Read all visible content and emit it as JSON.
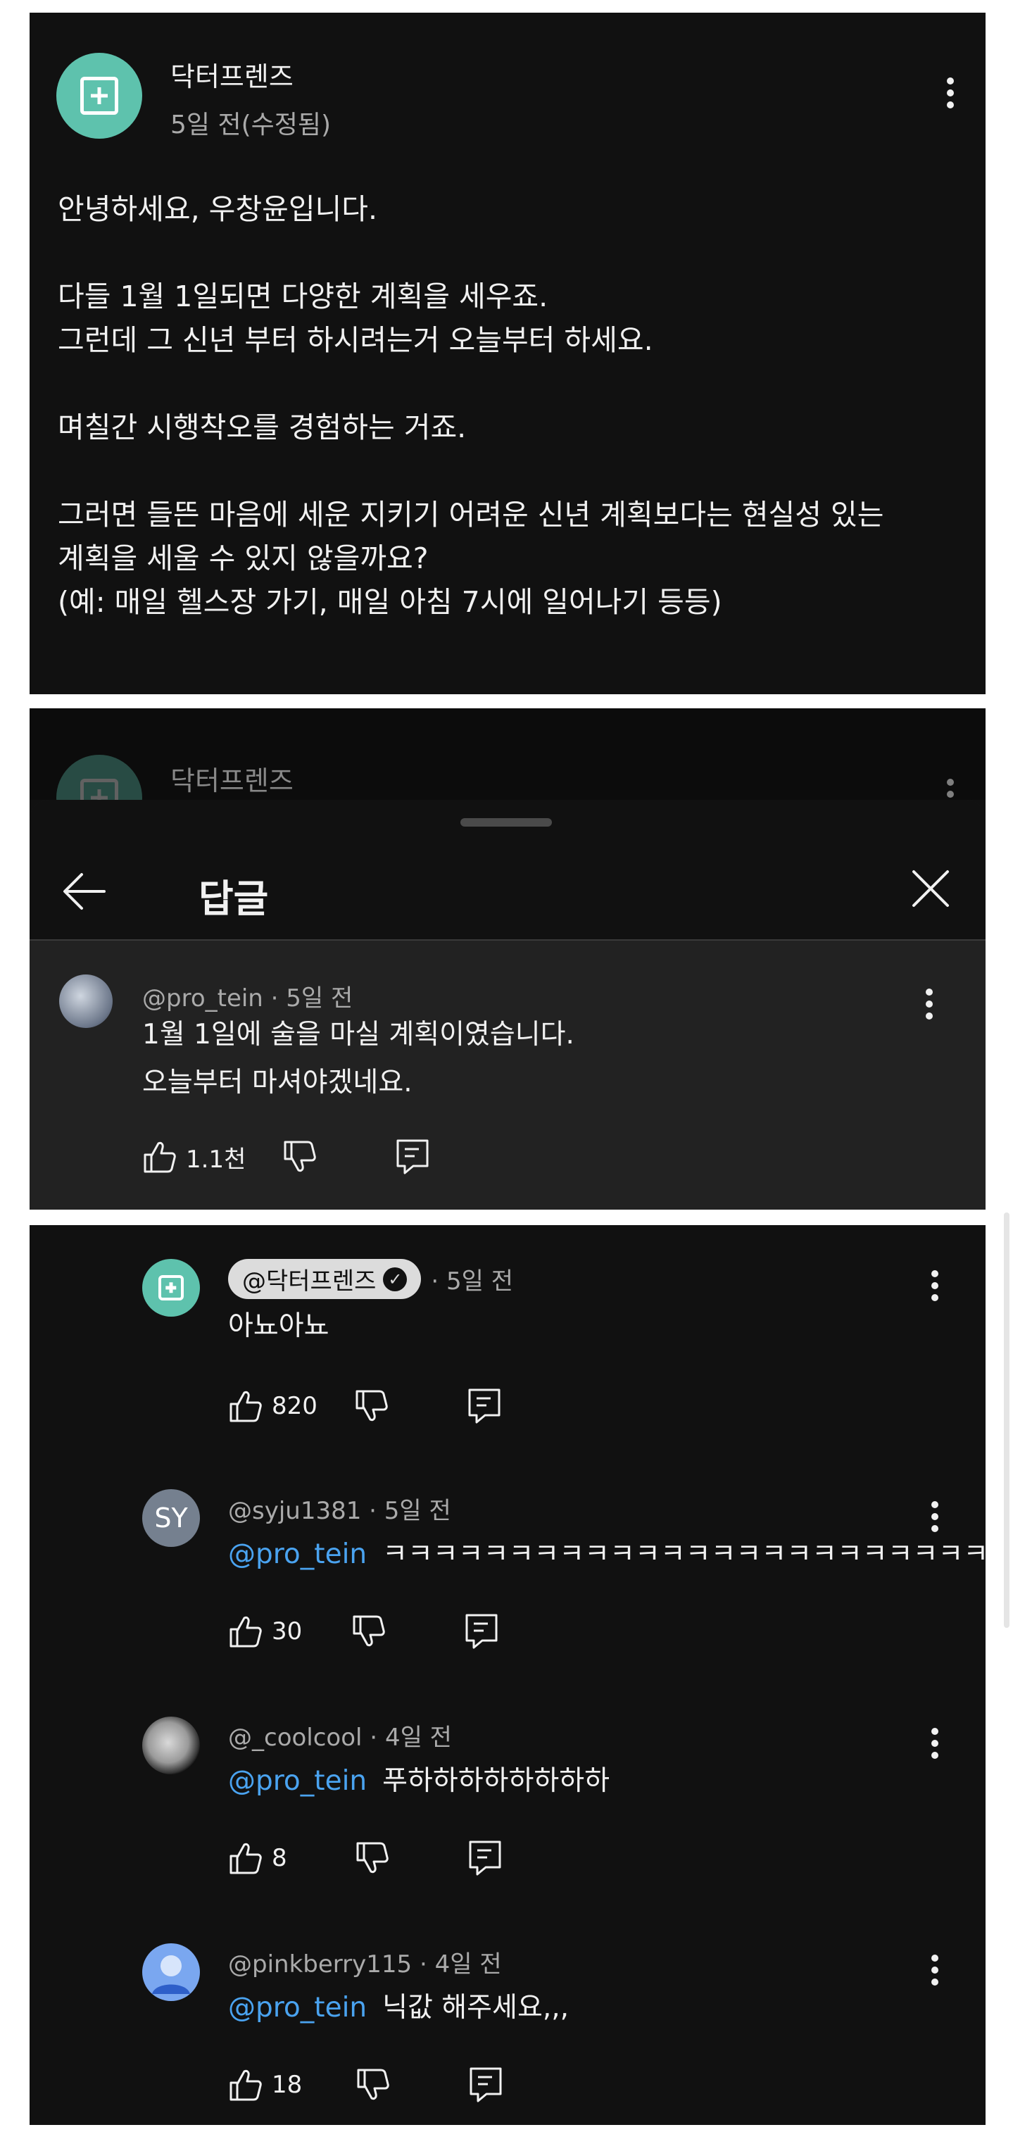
{
  "post": {
    "channel": "닥터프렌즈",
    "time": "5일 전(수정됨)",
    "lines": [
      "안녕하세요, 우창윤입니다.",
      "",
      "다들 1월 1일되면 다양한 계획을 세우죠.",
      "그런데 그 신년 부터 하시려는거 오늘부터 하세요.",
      "",
      "며칠간 시행착오를 경험하는 거죠.",
      "",
      "그러면 들뜬 마음에 세운 지키기 어려운 신년 계획보다는 현실성 있는",
      "계획을 세울 수 있지 않을까요?",
      "(예: 매일 헬스장 가기, 매일 아침 7시에 일어나기 등등)"
    ]
  },
  "sheet": {
    "behind_channel": "닥터프렌즈",
    "title": "답글"
  },
  "parent_comment": {
    "author": "@pro_tein",
    "time": "5일 전",
    "lines": [
      "1월 1일에 술을 마실 계획이였습니다.",
      "오늘부터 마셔야겠네요."
    ],
    "likes": "1.1천"
  },
  "replies": [
    {
      "author": "@닥터프렌즈",
      "verified": true,
      "time": "5일 전",
      "mention": "",
      "text": "아뇨아뇨",
      "likes": "820",
      "avatar": "channel-logo"
    },
    {
      "author": "@syju1381",
      "time": "5일 전",
      "mention": "@pro_tein",
      "text": "ㅋㅋㅋㅋㅋㅋㅋㅋㅋㅋㅋㅋㅋㅋㅋㅋㅋㅋㅋㅋㅋㅋㅋㅋㅋㅋㅋㅋㅋㅋㅋ",
      "likes": "30",
      "avatar_initials": "SY"
    },
    {
      "author": "@_coolcool",
      "time": "4일 전",
      "mention": "@pro_tein",
      "text": "푸하하하하하하하하",
      "likes": "8",
      "avatar": "moon"
    },
    {
      "author": "@pinkberry115",
      "time": "4일 전",
      "mention": "@pro_tein",
      "text": "닉값 해주세요,,,",
      "likes": "18",
      "avatar": "default-person"
    }
  ],
  "colors": {
    "background": "#111111",
    "sheet": "#222222",
    "mention": "#4aa3f0",
    "channel_avatar": "#5ec2ad",
    "secondary_text": "#aaaaaa"
  }
}
